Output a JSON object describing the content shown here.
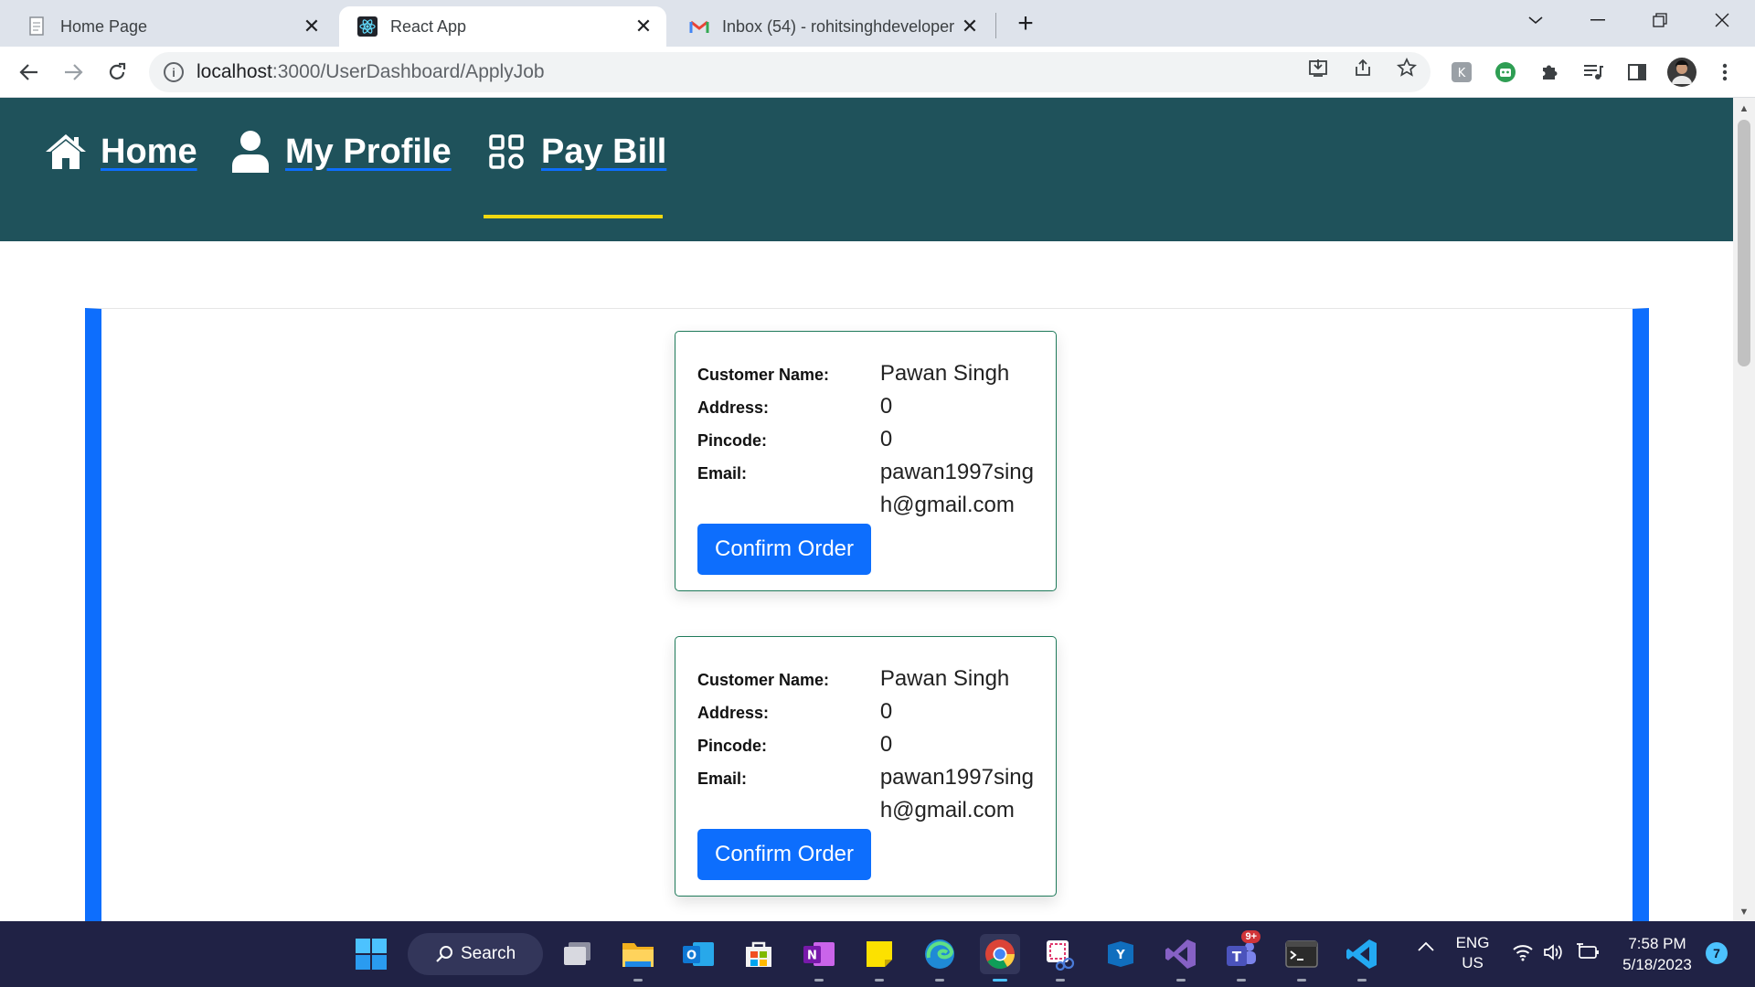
{
  "browser": {
    "tabs": [
      {
        "title": "Home Page",
        "icon": "document-icon"
      },
      {
        "title": "React App",
        "icon": "react-icon"
      },
      {
        "title": "Inbox (54) - rohitsinghdeveloper",
        "icon": "gmail-icon"
      }
    ],
    "url_host": "localhost",
    "url_path": ":3000/UserDashboard/ApplyJob"
  },
  "navbar": {
    "links": [
      {
        "label": "Home",
        "icon": "home-icon"
      },
      {
        "label": "My Profile",
        "icon": "user-icon"
      },
      {
        "label": "Pay Bill",
        "icon": "grid-icon"
      }
    ],
    "active": "Pay Bill",
    "bg_color": "#1f525b",
    "active_color": "#f1d810"
  },
  "orders": [
    {
      "customer_name_label": "Customer Name:",
      "customer_name": "Pawan Singh",
      "address_label": "Address:",
      "address": "0",
      "pincode_label": "Pincode:",
      "pincode": "0",
      "email_label": "Email:",
      "email": "pawan1997singh@gmail.com",
      "button_label": "Confirm Order"
    },
    {
      "customer_name_label": "Customer Name:",
      "customer_name": "Pawan Singh",
      "address_label": "Address:",
      "address": "0",
      "pincode_label": "Pincode:",
      "pincode": "0",
      "email_label": "Email:",
      "email": "pawan1997singh@gmail.com",
      "button_label": "Confirm Order"
    }
  ],
  "accent_color": "#0d6efd",
  "taskbar": {
    "search_label": "Search",
    "teams_badge": "9+",
    "language": "ENG",
    "region": "US",
    "time": "7:58 PM",
    "date": "5/18/2023",
    "notification_count": "7"
  }
}
